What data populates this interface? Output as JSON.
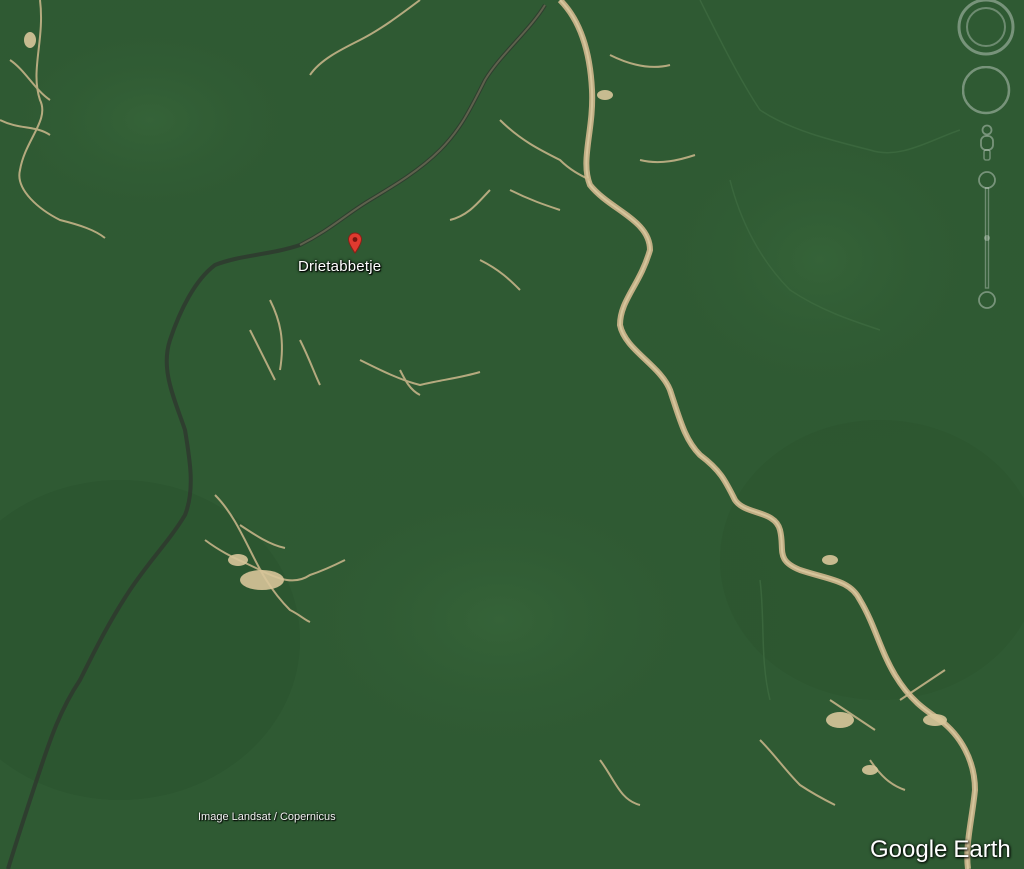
{
  "map": {
    "place_label": "Drietabbetje",
    "attribution": "Image Landsat / Copernicus",
    "brand": {
      "word1": "Google",
      "word2": "Earth"
    },
    "colors": {
      "forest": "#2f5a33",
      "forest_dark": "#264a2b",
      "river": "#c9b48a",
      "dark_river": "#2a3a2e",
      "pin": "#e03a2f"
    },
    "icons": [
      "map-pin-icon",
      "compass-ring-icon",
      "tilt-ring-icon",
      "pegman-icon",
      "zoom-slider-icon"
    ]
  }
}
